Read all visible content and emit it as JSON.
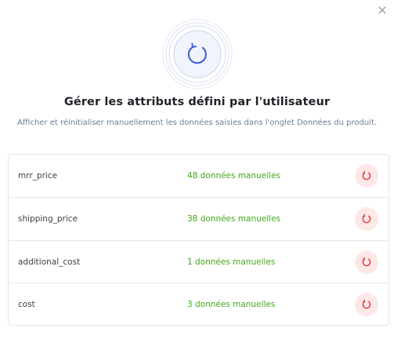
{
  "dialog": {
    "title": "Gérer les attributs défini par l'utilisateur",
    "subtitle": "Afficher et réinitialiser manuellement les données saisies dans l'onglet Données du produit.",
    "icons": {
      "close": "close-icon",
      "hero": "refresh-icon",
      "row_action": "reset-icon"
    },
    "colors": {
      "accent": "#3b5bdb",
      "count_text": "#43a81b",
      "reset_icon": "#e53935",
      "reset_bg": "#fde8e8"
    }
  },
  "attributes": [
    {
      "name": "mrr_price",
      "count": "48 données manuelles"
    },
    {
      "name": "shipping_price",
      "count": "38 données manuelles"
    },
    {
      "name": "additional_cost",
      "count": "1 données manuelles"
    },
    {
      "name": "cost",
      "count": "3 données manuelles"
    }
  ]
}
